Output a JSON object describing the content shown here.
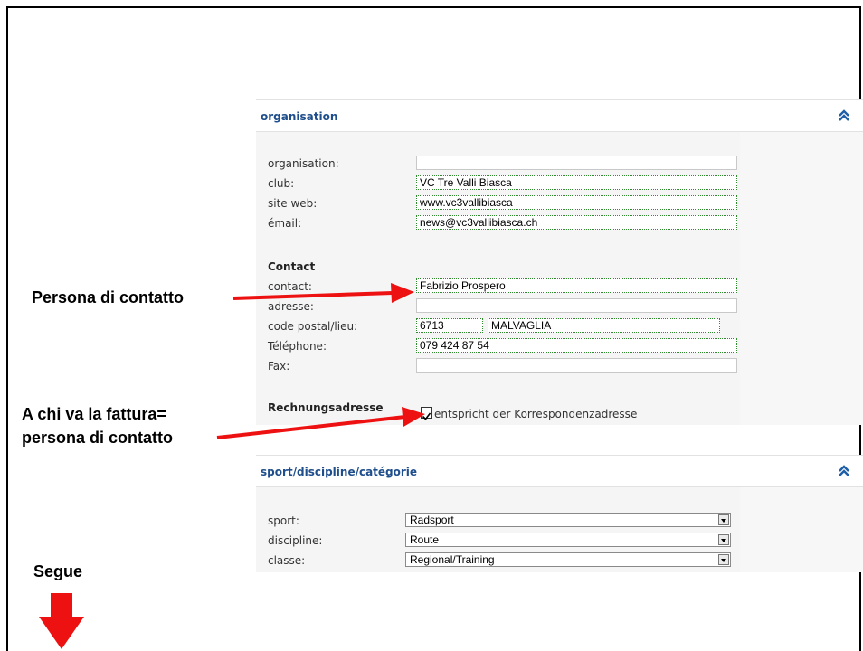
{
  "organisation_panel": {
    "title": "organisation",
    "fields": {
      "organisation": {
        "label": "organisation:",
        "value": ""
      },
      "club": {
        "label": "club:",
        "value": "VC Tre Valli Biasca"
      },
      "website": {
        "label": "site web:",
        "value": "www.vc3vallibiasca"
      },
      "email": {
        "label": "émail:",
        "value": "news@vc3vallibiasca.ch"
      }
    },
    "contact_heading": "Contact",
    "contact": {
      "contact": {
        "label": "contact:",
        "value": "Fabrizio Prospero"
      },
      "address": {
        "label": "adresse:",
        "value": ""
      },
      "postal": {
        "label": "code postal/lieu:",
        "code": "6713",
        "city": "MALVAGLIA"
      },
      "phone": {
        "label": "Téléphone:",
        "value": "079 424 87 54"
      },
      "fax": {
        "label": "Fax:",
        "value": ""
      }
    },
    "billing": {
      "heading": "Rechnungsadresse",
      "checkbox_label": "entspricht der Korrespondenzadresse",
      "checked": true
    }
  },
  "sport_panel": {
    "title": "sport/discipline/catégorie",
    "sport": {
      "label": "sport:",
      "value": "Radsport"
    },
    "discipline": {
      "label": "discipline:",
      "value": "Route"
    },
    "class": {
      "label": "classe:",
      "value": "Regional/Training"
    }
  },
  "annotations": {
    "contact_person": "Persona di contatto",
    "invoice_line1": "A chi va la fattura=",
    "invoice_line2": "persona di contatto",
    "continue": "Segue"
  },
  "colors": {
    "arrow": "#ee1111",
    "title_blue": "#1f4e8c",
    "filled_border": "#2e8b2e"
  },
  "icons": {
    "collapse": "double-chevron-up-icon",
    "continue": "down-arrow-icon"
  }
}
